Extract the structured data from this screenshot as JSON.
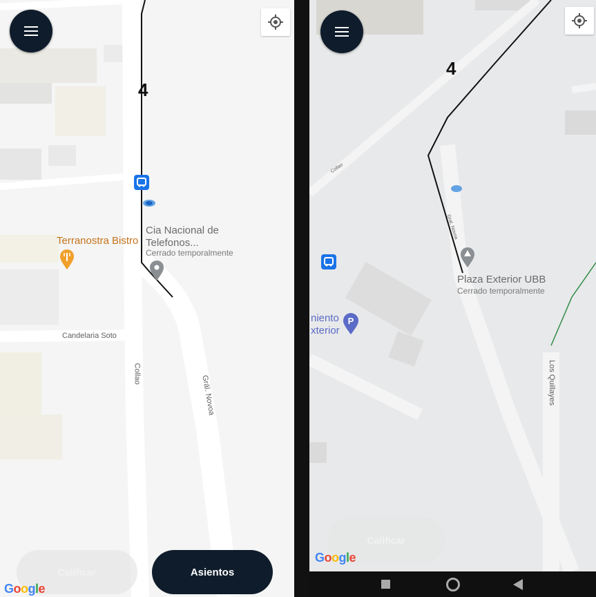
{
  "left_map": {
    "route_label": "4",
    "place_name": "Cia Nacional de Telefonos...",
    "place_status": "Cerrado temporalmente",
    "restaurant": "Terranostra Bistro",
    "street_candelaria": "Candelaria Soto",
    "street_collao": "Collao",
    "street_novoa": "Grál. Novoa",
    "rate_label": "Calificar",
    "seats_label": "Asientos"
  },
  "right_map": {
    "route_label": "4",
    "place_name": "Plaza Exterior UBB",
    "place_status": "Cerrado temporalmente",
    "parking_label_line1": "niento",
    "parking_label_line2": "xterior",
    "street_quillayes": "Los Quillayes",
    "street_small": "Collao",
    "street_diag": "Gral. Novoa",
    "rate_label": "Calificar"
  },
  "google_logo": "Google",
  "icons": {
    "menu": "hamburger-menu-icon",
    "locate": "my-location-icon",
    "bus": "bus-stop-icon",
    "nav_recent": "square-icon",
    "nav_home": "circle-icon",
    "nav_back": "triangle-back-icon"
  },
  "colors": {
    "button_dark": "#0f1c2b",
    "bus_blue": "#1a73e8",
    "restaurant_orange": "#c5721b"
  }
}
